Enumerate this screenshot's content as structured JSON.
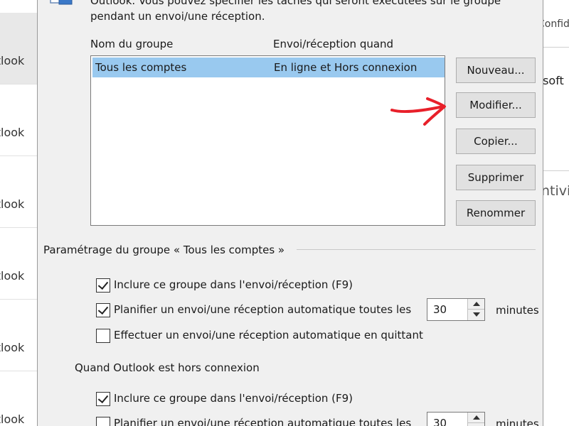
{
  "background": {
    "list_items": [
      {
        "label": "Outlook",
        "selected": true
      },
      {
        "label": "Outlook",
        "selected": false
      },
      {
        "label": "Outlook",
        "selected": false
      },
      {
        "label": "Outlook",
        "selected": false
      },
      {
        "label": "Outlook",
        "selected": false
      },
      {
        "label": "Outlook",
        "selected": false
      }
    ],
    "right_text_1": "Confiden",
    "right_text_2": "Microsoft",
    "right_text_3": "Antivi"
  },
  "dialog": {
    "intro_line1": "Outlook. Vous pouvez spécifier les tâches qui seront exécutées sur le groupe",
    "intro_line2": "pendant un envoi/une réception.",
    "columns": {
      "name": "Nom du groupe",
      "when": "Envoi/réception quand"
    },
    "groups": [
      {
        "name": "Tous les comptes",
        "when": "En ligne et Hors connexion",
        "selected": true
      }
    ],
    "buttons": {
      "new": "Nouveau...",
      "edit": "Modifier...",
      "copy": "Copier...",
      "delete": "Supprimer",
      "rename": "Renommer"
    },
    "online_section": {
      "title": "Paramétrage du groupe « Tous les comptes »",
      "include": {
        "label": "Inclure ce groupe dans l'envoi/réception (F9)",
        "checked": true
      },
      "schedule": {
        "label": "Planifier un envoi/une réception automatique toutes les",
        "checked": true,
        "value": "30",
        "unit": "minutes"
      },
      "on_exit": {
        "label": "Effectuer un envoi/une réception automatique en quittant",
        "checked": false
      }
    },
    "offline_section": {
      "title": "Quand Outlook est hors connexion",
      "include": {
        "label": "Inclure ce groupe dans l'envoi/réception (F9)",
        "checked": true
      },
      "schedule": {
        "label": "Planifier un envoi/une réception automatique toutes les",
        "checked": false,
        "value": "30",
        "unit": "minutes"
      }
    }
  },
  "colors": {
    "selection": "#99c9ef",
    "dialog_bg": "#f0f0f0",
    "annotation": "#e8202a"
  },
  "icons": [
    "checkbox-icon",
    "spin-up-icon",
    "spin-down-icon",
    "red-arrow-annotation"
  ]
}
